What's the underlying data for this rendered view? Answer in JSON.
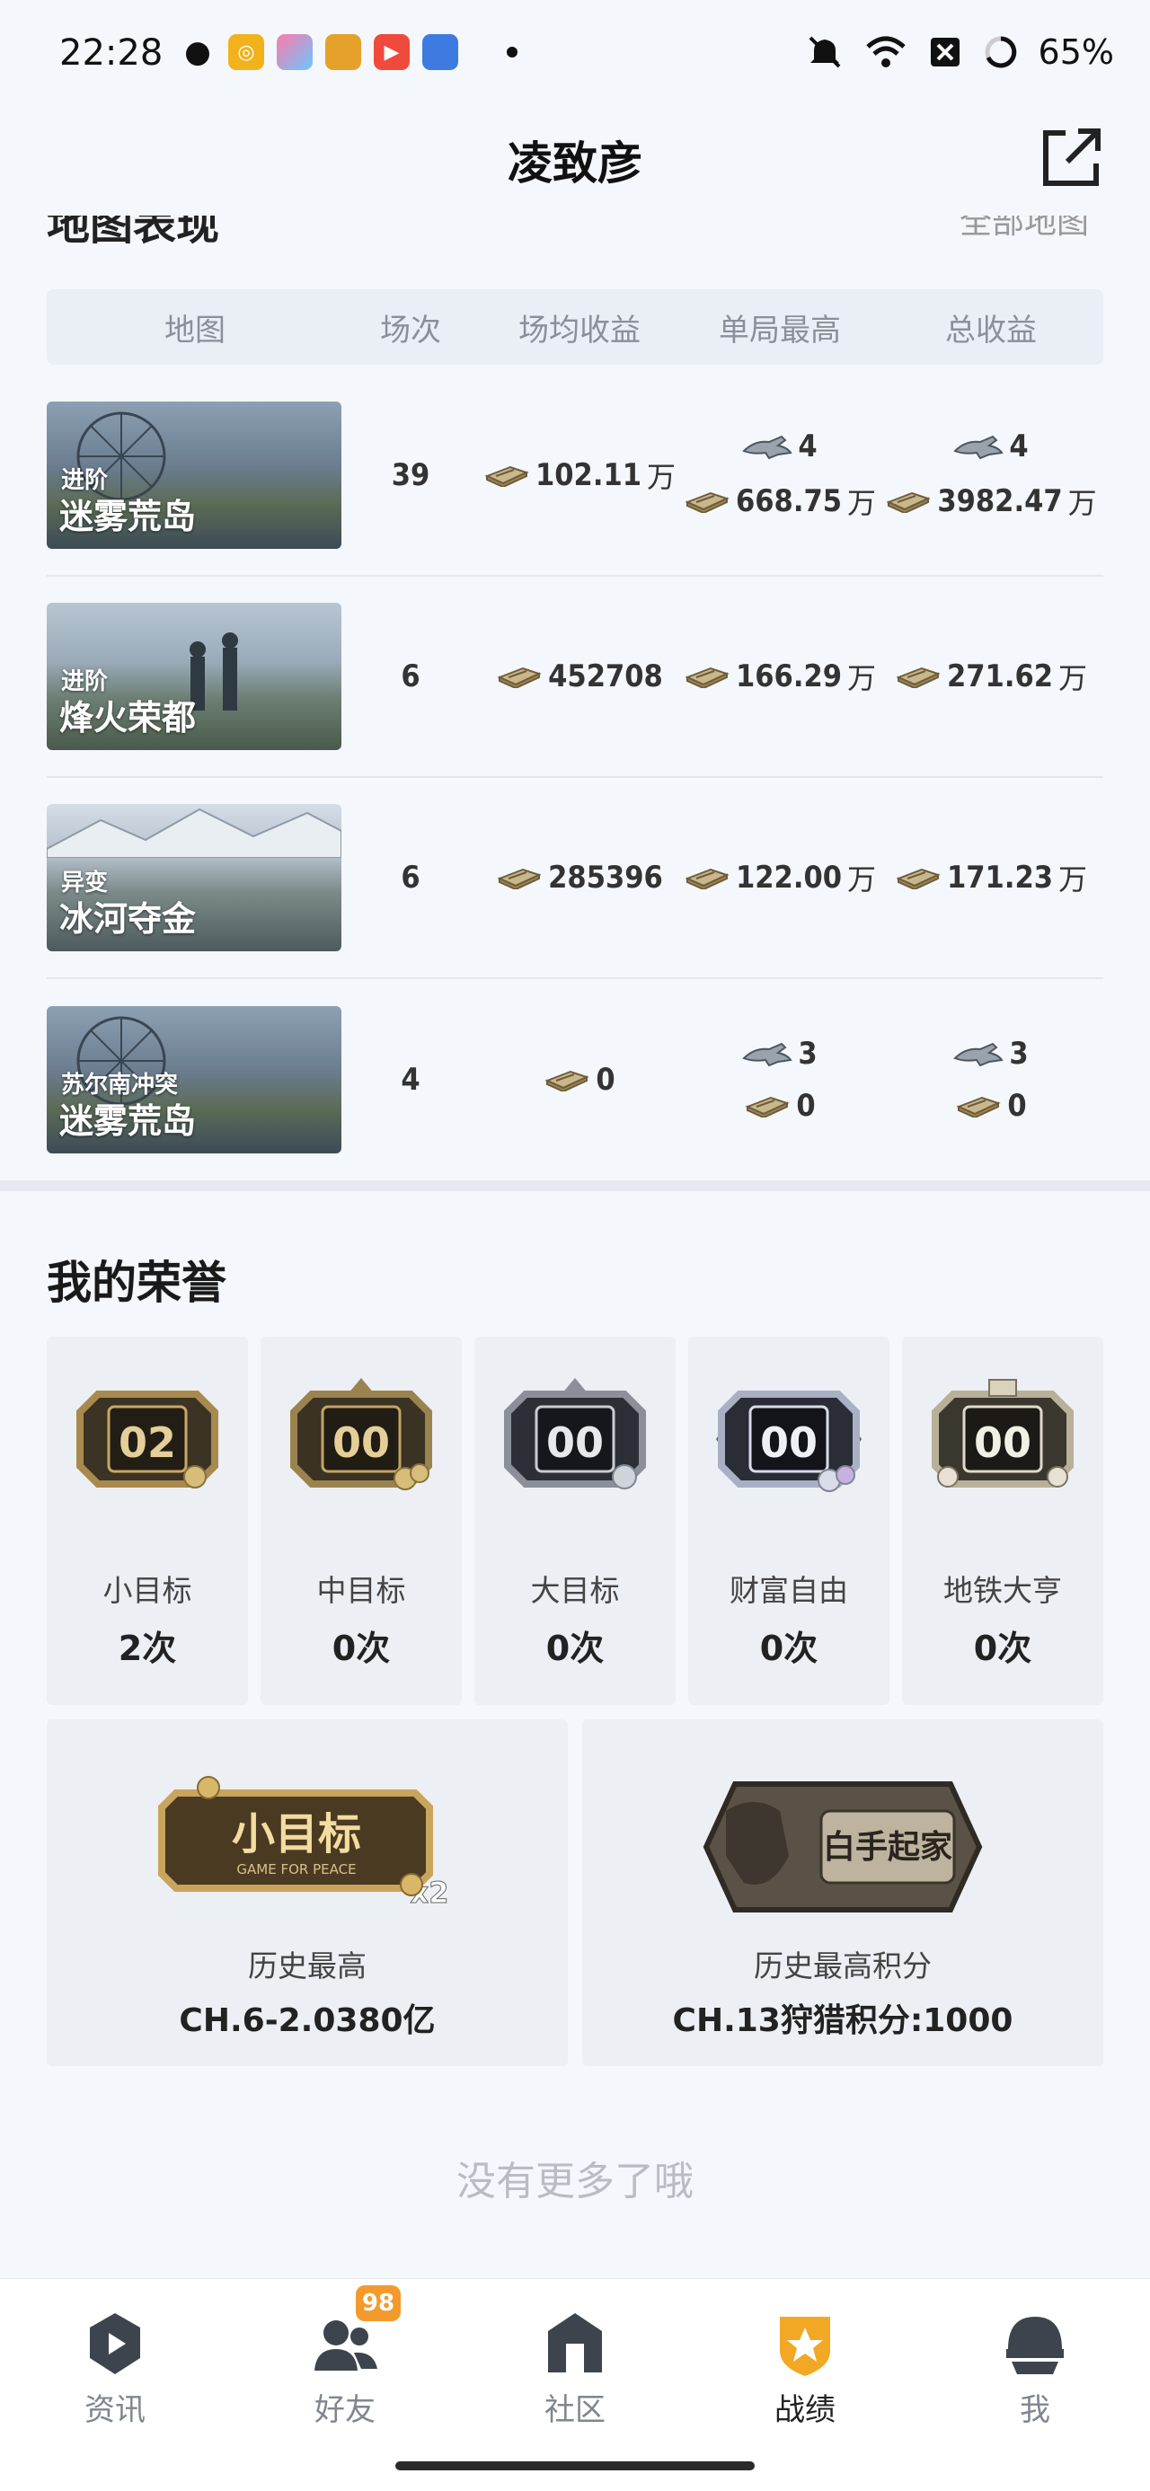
{
  "status_bar": {
    "time": "22:28",
    "battery": "65%",
    "app_icons": [
      "wechat-icon",
      "app-yellow-icon",
      "app-gallery-icon",
      "app-game-icon",
      "video-play-icon",
      "app-cat-icon"
    ]
  },
  "header": {
    "title": "凌致彦",
    "share_icon": "share-export-icon"
  },
  "peek": {
    "left": "地图表现",
    "right": "全部地图"
  },
  "table": {
    "headers": [
      "地图",
      "场次",
      "场均收益",
      "单局最高",
      "总收益"
    ],
    "rows": [
      {
        "mode": "进阶",
        "map": "迷雾荒岛",
        "games": "39",
        "avg": "102.11",
        "avg_unit": "万",
        "best_plane": "4",
        "best": "668.75",
        "best_unit": "万",
        "total_plane": "4",
        "total": "3982.47",
        "total_unit": "万"
      },
      {
        "mode": "进阶",
        "map": "烽火荣都",
        "games": "6",
        "avg": "452708",
        "avg_unit": "",
        "best_plane": "",
        "best": "166.29",
        "best_unit": "万",
        "total_plane": "",
        "total": "271.62",
        "total_unit": "万"
      },
      {
        "mode": "异变",
        "map": "冰河夺金",
        "games": "6",
        "avg": "285396",
        "avg_unit": "",
        "best_plane": "",
        "best": "122.00",
        "best_unit": "万",
        "total_plane": "",
        "total": "171.23",
        "total_unit": "万"
      },
      {
        "mode": "苏尔南冲突",
        "map": "迷雾荒岛",
        "games": "4",
        "avg": "0",
        "avg_unit": "",
        "best_plane": "3",
        "best": "0",
        "best_unit": "",
        "total_plane": "3",
        "total": "0",
        "total_unit": ""
      }
    ]
  },
  "honor": {
    "title": "我的荣誉",
    "badges": [
      {
        "number": "02",
        "label": "小目标",
        "count": "2次",
        "tone": "#a88a4e"
      },
      {
        "number": "00",
        "label": "中目标",
        "count": "0次",
        "tone": "#9b8350"
      },
      {
        "number": "00",
        "label": "大目标",
        "count": "0次",
        "tone": "#8a8f9a"
      },
      {
        "number": "00",
        "label": "财富自由",
        "count": "0次",
        "tone": "#7a7f8c"
      },
      {
        "number": "00",
        "label": "地铁大亨",
        "count": "0次",
        "tone": "#b9b09a"
      }
    ],
    "cards": [
      {
        "art_text": "小目标",
        "art_sub": "GAME FOR PEACE",
        "art_mult": "x2",
        "label": "历史最高",
        "value": "CH.6-2.0380亿"
      },
      {
        "art_text": "白手起家",
        "label": "历史最高积分",
        "value": "CH.13狩猎积分:1000"
      }
    ]
  },
  "footer_note": "没有更多了哦",
  "nav": {
    "items": [
      {
        "label": "资讯",
        "icon": "news-icon"
      },
      {
        "label": "好友",
        "icon": "friends-icon",
        "badge": "98"
      },
      {
        "label": "社区",
        "icon": "community-icon"
      },
      {
        "label": "战绩",
        "icon": "record-shield-icon",
        "active": true
      },
      {
        "label": "我",
        "icon": "profile-helmet-icon"
      }
    ]
  },
  "colors": {
    "accent": "#f3a825",
    "background": "#f4f7fc",
    "card": "#eceff4"
  }
}
